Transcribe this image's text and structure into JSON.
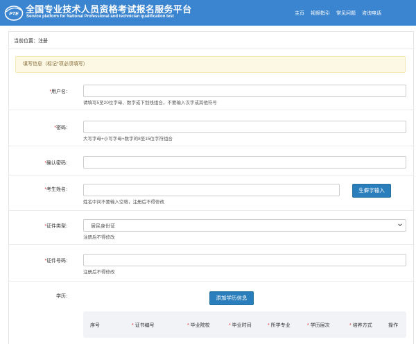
{
  "header": {
    "title": "全国专业技术人员资格考试报名服务平台",
    "subtitle": "Service platform for National Professional and technician qualification test",
    "logo_text": "PTE",
    "nav": [
      "主页",
      "视频指引",
      "常见问题",
      "咨询电话"
    ]
  },
  "breadcrumb": "当前位置：注册",
  "notice": "填写信息（标记*项必须填写）",
  "form": {
    "username": {
      "label": "用户名:",
      "hint": "请填写5至20位字母、数字或下划线组合，不要输入汉字或其他符号"
    },
    "password": {
      "label": "密码:",
      "hint": "大写字母+小写字母+数字的8至15位字符组合"
    },
    "confirm": {
      "label": "确认密码:"
    },
    "name": {
      "label": "考生姓名:",
      "hint": "姓名中间不要输入空格，注册后不得修改",
      "button": "生僻字输入"
    },
    "id_type": {
      "label": "证件类型:",
      "value": "居民身份证",
      "hint": "注册后不得修改"
    },
    "id_number": {
      "label": "证件号码:",
      "hint": "注册后不得修改"
    },
    "education": {
      "label": "学历:",
      "button": "添加学历信息"
    }
  },
  "required_mark": "*",
  "table": {
    "columns": [
      "序号",
      "证书编号",
      "毕业院校",
      "毕业时间",
      "所学专业",
      "学历层次",
      "培养方式",
      "操作"
    ],
    "required": [
      false,
      true,
      true,
      true,
      true,
      true,
      true,
      false
    ]
  },
  "colors": {
    "header": "#3a84d0",
    "button": "#2a7ebc",
    "notice_bg": "#fcf8e3",
    "required": "#e33333"
  }
}
